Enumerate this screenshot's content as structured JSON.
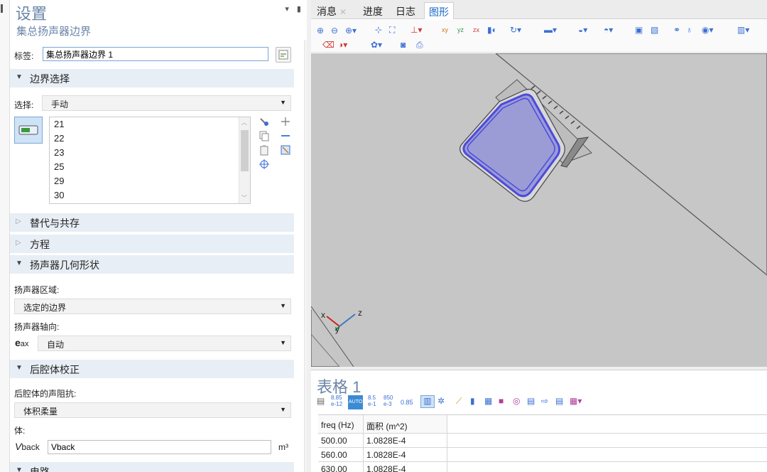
{
  "settings": {
    "title": "设置",
    "subtitle": "集总扬声器边界",
    "label_caption": "标签:",
    "label_value": "集总扬声器边界 1",
    "boundary_section": "边界选择",
    "selection_caption": "选择:",
    "selection_value": "手动",
    "boundary_list": [
      "21",
      "22",
      "23",
      "25",
      "29",
      "30"
    ],
    "section_coexist": "替代与共存",
    "section_equation": "方程",
    "section_geometry": "扬声器几何形状",
    "speaker_region_caption": "扬声器区域:",
    "speaker_region_value": "选定的边界",
    "speaker_axis_caption": "扬声器轴向:",
    "axis_symbol": "e",
    "axis_sub": "ax",
    "axis_value": "自动",
    "section_backvol": "后腔体校正",
    "impedance_caption": "后腔体的声阻抗:",
    "impedance_value": "体积柔量",
    "volume_caption": "体:",
    "vback_symbol": "V",
    "vback_sub": "back",
    "vback_value": "Vback",
    "vback_unit": "m³",
    "section_circuit": "电路"
  },
  "graphics": {
    "tabs": [
      {
        "label": "消息",
        "closable": true
      },
      {
        "label": "进度",
        "closable": false
      },
      {
        "label": "日志",
        "closable": false
      },
      {
        "label": "图形",
        "closable": false
      }
    ],
    "active_tab": "图形",
    "axes": {
      "x": "x",
      "y": "y",
      "z": "z"
    },
    "selection_color": "#4b4bdc",
    "background_color": "#ececec"
  },
  "table": {
    "title": "表格 1",
    "tool_labels": [
      "8.85\ne-12",
      "AUTO",
      "8.5\ne-1",
      "850\ne-3",
      "0.85"
    ],
    "columns": [
      "freq (Hz)",
      "面积 (m^2)"
    ],
    "rows": [
      [
        "500.00",
        "1.0828E-4"
      ],
      [
        "560.00",
        "1.0828E-4"
      ],
      [
        "630.00",
        "1.0828E-4"
      ]
    ]
  }
}
